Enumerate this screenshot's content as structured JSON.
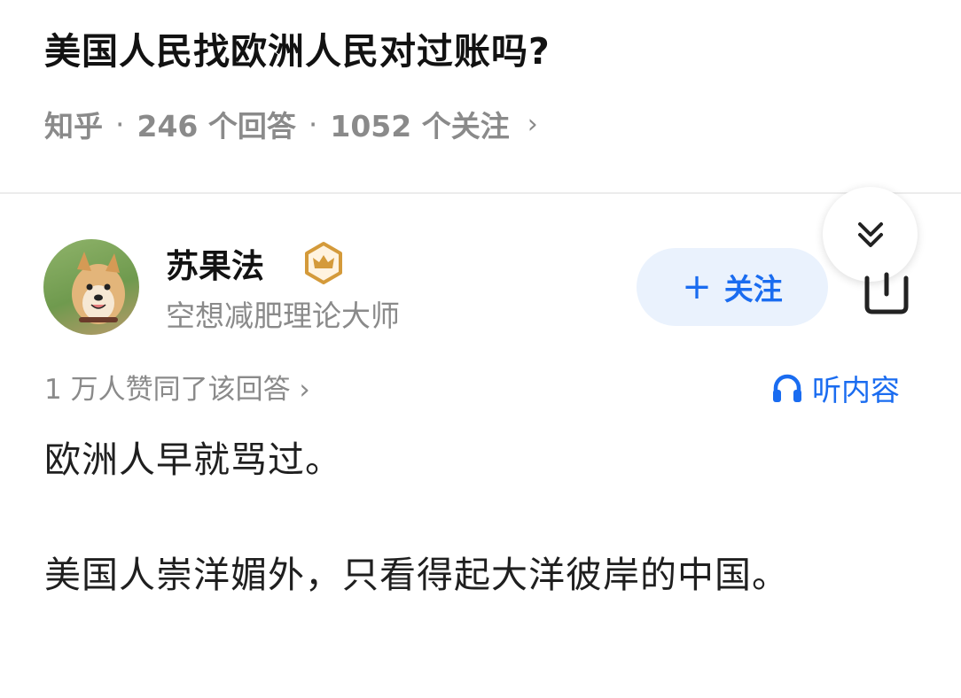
{
  "question": {
    "title": "美国人民找欧洲人民对过账吗?",
    "meta": {
      "source": "知乎",
      "separator": "·",
      "answers": "246 个回答",
      "followers": "1052 个关注",
      "chevron": "›"
    }
  },
  "answer": {
    "author": {
      "name": "苏果法",
      "description": "空想减肥理论大师",
      "badge_icon": "crown-badge-icon"
    },
    "follow_button": {
      "plus": "+",
      "label": "关注"
    },
    "votes": "1 万人赞同了该回答 ›",
    "listen_label": "听内容",
    "paragraphs": [
      "欧洲人早就骂过。",
      "美国人崇洋媚外，只看得起大洋彼岸的中国。"
    ]
  },
  "colors": {
    "accent": "#1a6cf0",
    "accent_bg": "#eaf2fd",
    "badge": "#d49a3a",
    "meta_text": "#8a8a8a"
  }
}
